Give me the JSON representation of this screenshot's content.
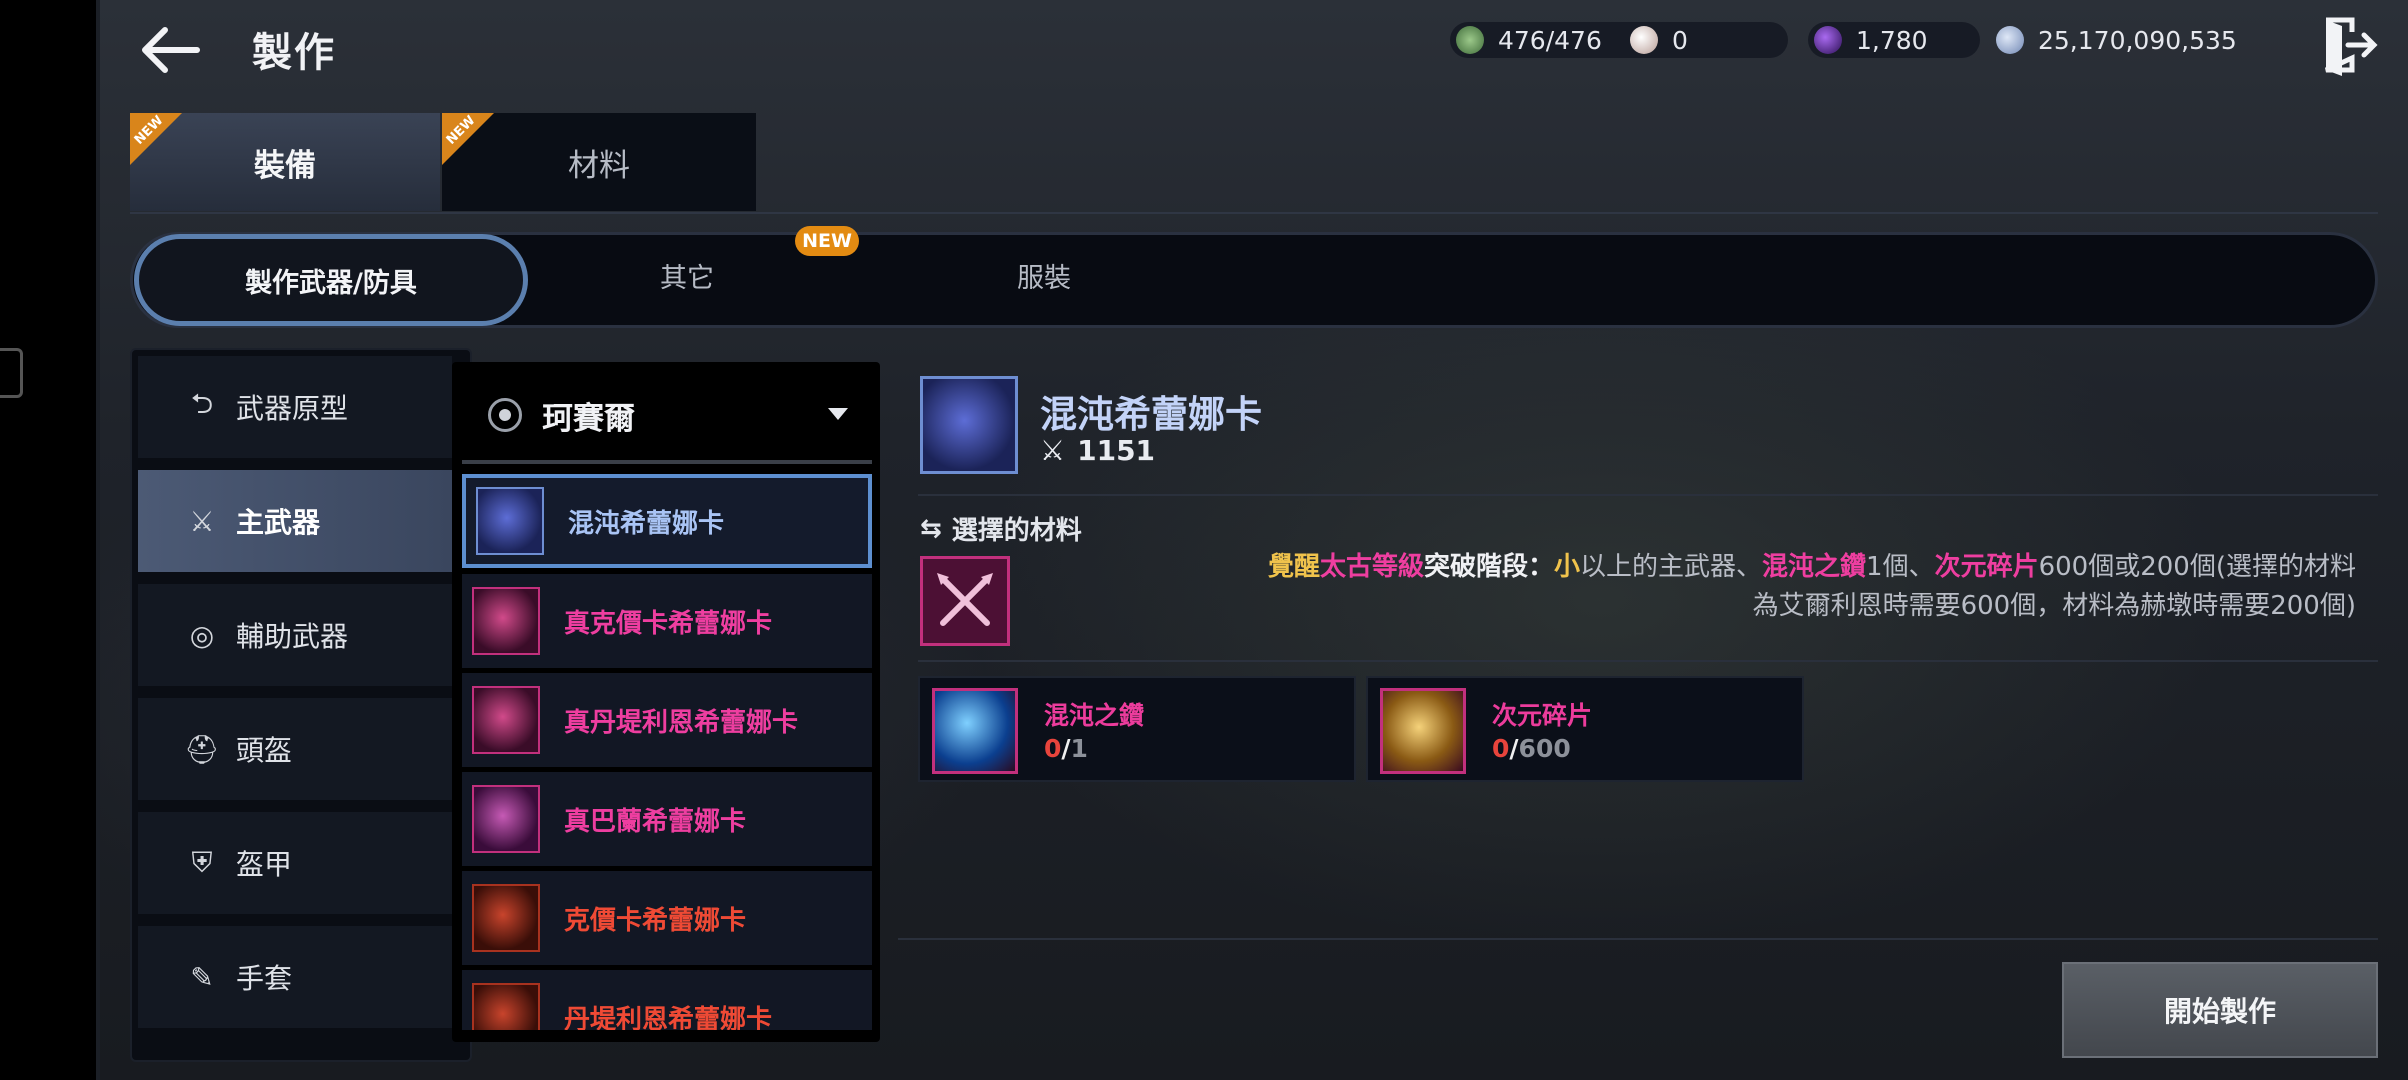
{
  "header": {
    "title": "製作",
    "resources": [
      {
        "icon": "stamina-icon",
        "value": "476/476",
        "color": "#6aa36a"
      },
      {
        "icon": "pearl-icon",
        "value": "0",
        "color": "#d9c7c2"
      },
      {
        "icon": "dark-orb-icon",
        "value": "1,780",
        "color": "#6b2fbf"
      },
      {
        "icon": "silver-coin-icon",
        "value": "25,170,090,535",
        "color": "#9fb3d6"
      }
    ]
  },
  "tabs": {
    "equipment": "裝備",
    "materials": "材料",
    "new_corner": "NEW"
  },
  "subtabs": {
    "weapons_armor": "製作武器/防具",
    "other": "其它",
    "costume": "服裝",
    "new_badge": "NEW"
  },
  "categories": [
    {
      "label": "武器原型",
      "icon": "return-arrow-icon"
    },
    {
      "label": "主武器",
      "icon": "crossed-swords-icon"
    },
    {
      "label": "輔助武器",
      "icon": "ring-target-icon"
    },
    {
      "label": "頭盔",
      "icon": "helmet-icon"
    },
    {
      "label": "盔甲",
      "icon": "armor-icon"
    },
    {
      "label": "手套",
      "icon": "glove-icon"
    }
  ],
  "dropdown": {
    "selected": "珂賽爾"
  },
  "items": [
    {
      "name": "混沌希蕾娜卡",
      "color": "#a9c4f5"
    },
    {
      "name": "真克價卡希蕾娜卡",
      "color": "#ee3ea0"
    },
    {
      "name": "真丹堤利恩希蕾娜卡",
      "color": "#ee3ea0"
    },
    {
      "name": "真巴蘭希蕾娜卡",
      "color": "#ee3ea0"
    },
    {
      "name": "克價卡希蕾娜卡",
      "color": "#ef4a35"
    },
    {
      "name": "丹堤利恩希蕾娜卡",
      "color": "#ef4a35"
    }
  ],
  "detail": {
    "name": "混沌希蕾娜卡",
    "power": "1151",
    "selected_material_heading": "選擇的材料",
    "desc": {
      "p1": "覺醒",
      "p2": "太古等級",
      "p3": "突破階段：",
      "p4": "小",
      "p5": "以上的主武器、",
      "p6": "混沌之鑽",
      "p7": "1個、",
      "p8": "次元碎片",
      "p9": "600個或200個(選擇的材料",
      "line2": "為艾爾利恩時需要600個，材料為赫墩時需要200個)"
    },
    "requirements": [
      {
        "name": "混沌之鑽",
        "have": "0",
        "need": "1",
        "icon": "blue-gem-icon"
      },
      {
        "name": "次元碎片",
        "have": "0",
        "need": "600",
        "icon": "gold-shard-icon"
      }
    ],
    "start_button": "開始製作"
  }
}
